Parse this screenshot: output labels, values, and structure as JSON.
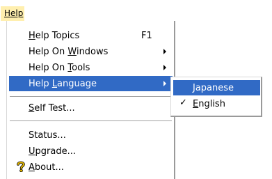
{
  "menubar": {
    "help": "Help"
  },
  "help_menu": {
    "items": [
      {
        "label": "Help Topics",
        "shortcut": "F1"
      },
      {
        "label": "Help On Windows"
      },
      {
        "label": "Help On Tools"
      },
      {
        "label": "Help Language"
      },
      {
        "label": "Self Test..."
      },
      {
        "label": "Status..."
      },
      {
        "label": "Upgrade..."
      },
      {
        "label": "About...",
        "icon": "question-mark-icon"
      }
    ]
  },
  "language_submenu": {
    "items": [
      {
        "label": "Japanese",
        "checked": false
      },
      {
        "label": "English",
        "checked": true
      }
    ]
  },
  "colors": {
    "selection": "#316ac5",
    "menubar_highlight": "#ffefaf",
    "about_icon": "#e6b800"
  }
}
